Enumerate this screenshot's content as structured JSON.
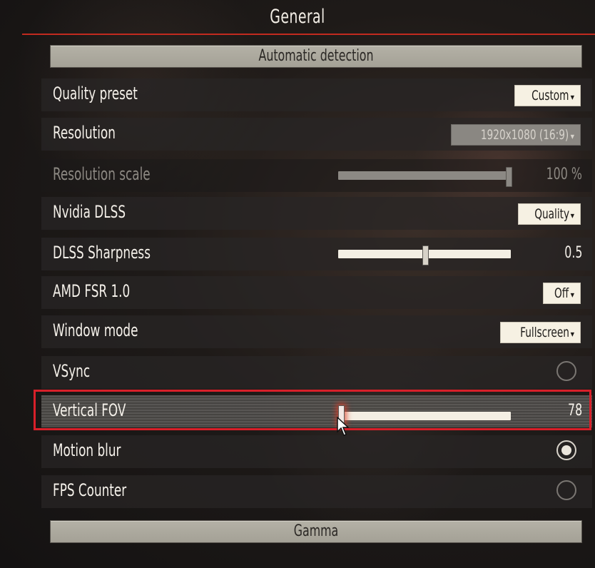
{
  "header": {
    "title": "General"
  },
  "sections": {
    "automatic_detection": "Automatic detection",
    "gamma": "Gamma"
  },
  "settings": {
    "quality_preset": {
      "label": "Quality preset",
      "value": "Custom"
    },
    "resolution": {
      "label": "Resolution",
      "value": "1920x1080 (16:9)"
    },
    "resolution_scale": {
      "label": "Resolution scale",
      "value_text": "100 %",
      "fraction": 1.0
    },
    "nvidia_dlss": {
      "label": "Nvidia DLSS",
      "value": "Quality"
    },
    "dlss_sharpness": {
      "label": "DLSS Sharpness",
      "value_text": "0.5",
      "fraction": 0.5
    },
    "amd_fsr": {
      "label": "AMD FSR 1.0",
      "value": "Off"
    },
    "window_mode": {
      "label": "Window mode",
      "value": "Fullscreen"
    },
    "vsync": {
      "label": "VSync",
      "checked": false
    },
    "vertical_fov": {
      "label": "Vertical FOV",
      "value_text": "78",
      "fraction": 0.0
    },
    "motion_blur": {
      "label": "Motion blur",
      "checked": true
    },
    "fps_counter": {
      "label": "FPS Counter",
      "checked": false
    }
  },
  "icons": {
    "dropdown_caret": "▾",
    "cursor": "mouse-pointer-icon"
  },
  "colors": {
    "accent_red": "#c22a1f",
    "highlight_red": "#d8202a"
  }
}
